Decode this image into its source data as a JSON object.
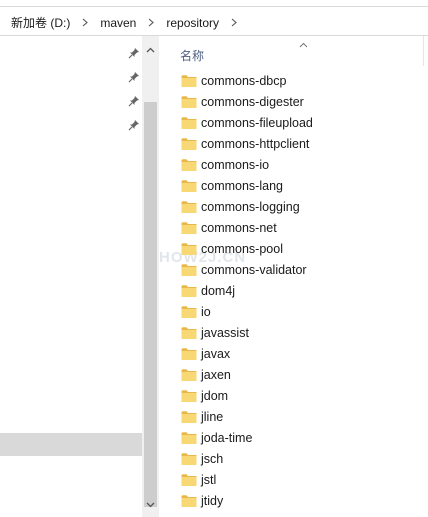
{
  "breadcrumb": [
    "新加卷 (D:)",
    "maven",
    "repository"
  ],
  "header": {
    "name_column": "名称"
  },
  "folders": [
    "commons-dbcp",
    "commons-digester",
    "commons-fileupload",
    "commons-httpclient",
    "commons-io",
    "commons-lang",
    "commons-logging",
    "commons-net",
    "commons-pool",
    "commons-validator",
    "dom4j",
    "io",
    "javassist",
    "javax",
    "jaxen",
    "jdom",
    "jline",
    "joda-time",
    "jsch",
    "jstl",
    "jtidy"
  ],
  "watermark": "HOW2J.CN",
  "colors": {
    "folder": "#f8d775",
    "folder_dark": "#e8b84a",
    "selection": "#d9d9d9",
    "header_text": "#4d6082"
  },
  "icons": {
    "pin": "pin-icon",
    "folder": "folder-icon",
    "chevron": "chevron-right-icon"
  }
}
